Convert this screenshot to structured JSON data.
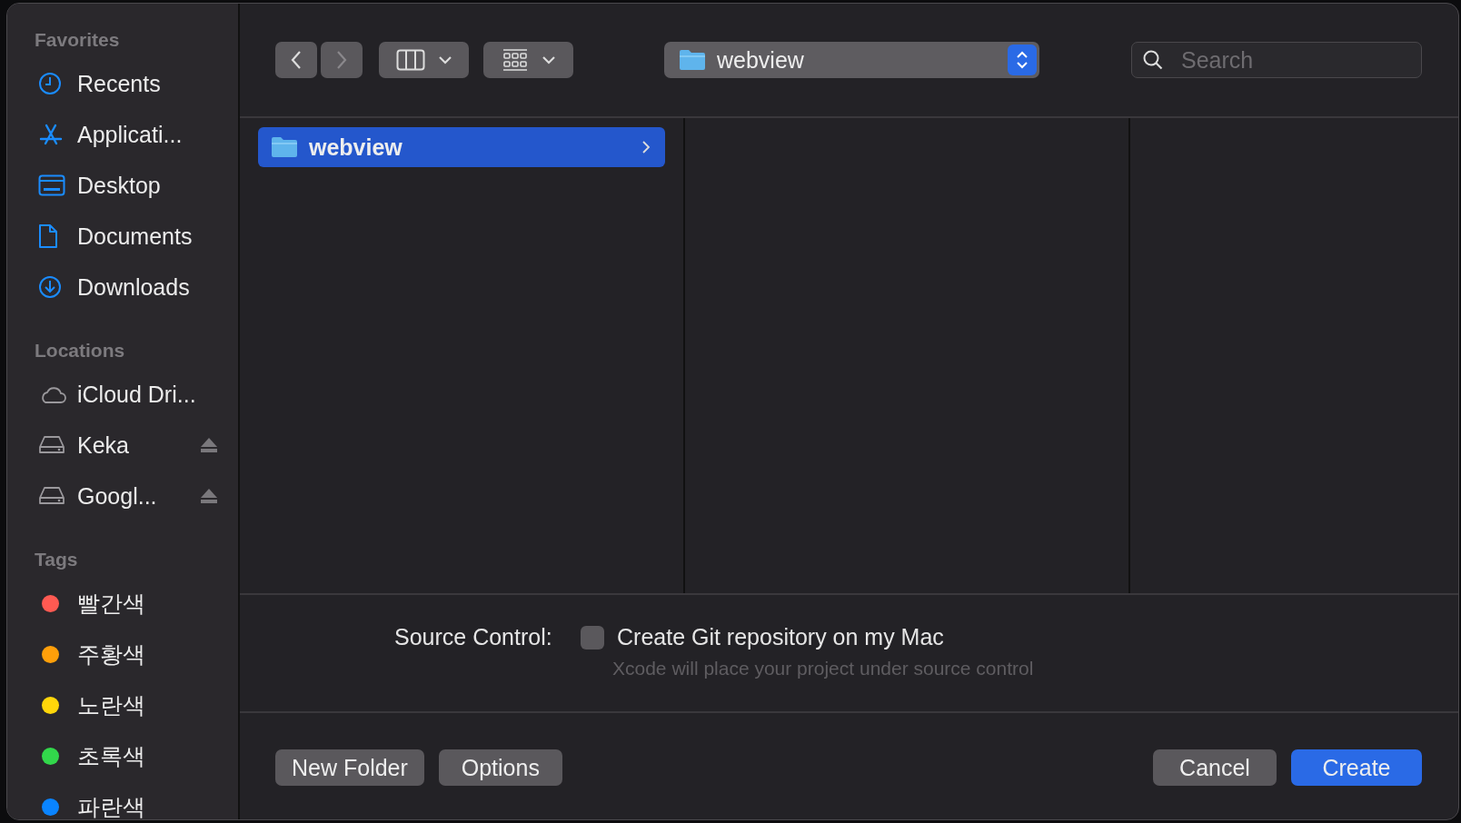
{
  "sidebar": {
    "sections": [
      {
        "title": "Favorites",
        "items": [
          {
            "label": "Recents",
            "kind": "clock"
          },
          {
            "label": "Applicati...",
            "kind": "apps"
          },
          {
            "label": "Desktop",
            "kind": "desktop"
          },
          {
            "label": "Documents",
            "kind": "document"
          },
          {
            "label": "Downloads",
            "kind": "download"
          }
        ]
      },
      {
        "title": "Locations",
        "items": [
          {
            "label": "iCloud Dri...",
            "kind": "cloud",
            "eject": false
          },
          {
            "label": "Keka",
            "kind": "drive",
            "eject": true
          },
          {
            "label": "Googl...",
            "kind": "drive",
            "eject": true
          }
        ]
      },
      {
        "title": "Tags",
        "items": [
          {
            "label": "빨간색",
            "kind": "tag",
            "color": "#ff5a52"
          },
          {
            "label": "주황색",
            "kind": "tag",
            "color": "#ff9f0a"
          },
          {
            "label": "노란색",
            "kind": "tag",
            "color": "#ffd60a"
          },
          {
            "label": "초록색",
            "kind": "tag",
            "color": "#32d74b"
          },
          {
            "label": "파란색",
            "kind": "tag",
            "color": "#0a84ff"
          }
        ]
      }
    ]
  },
  "toolbar": {
    "back": {
      "disabled": false
    },
    "forward": {
      "disabled": true
    },
    "path": "webview",
    "search": {
      "placeholder": "Search"
    }
  },
  "browser": {
    "columns": [
      {
        "items": [
          {
            "name": "webview",
            "selected": true,
            "has_children": true
          }
        ]
      },
      {},
      {}
    ]
  },
  "source_control": {
    "label": "Source Control:",
    "checkbox": {
      "label": "Create Git repository on my Mac",
      "checked": false
    },
    "note": "Xcode will place your project under source control"
  },
  "buttons_left": [
    {
      "label": "New Folder",
      "default": false
    },
    {
      "label": "Options",
      "default": false
    }
  ],
  "buttons_right": [
    {
      "label": "Cancel",
      "default": false
    },
    {
      "label": "Create",
      "default": true
    }
  ]
}
